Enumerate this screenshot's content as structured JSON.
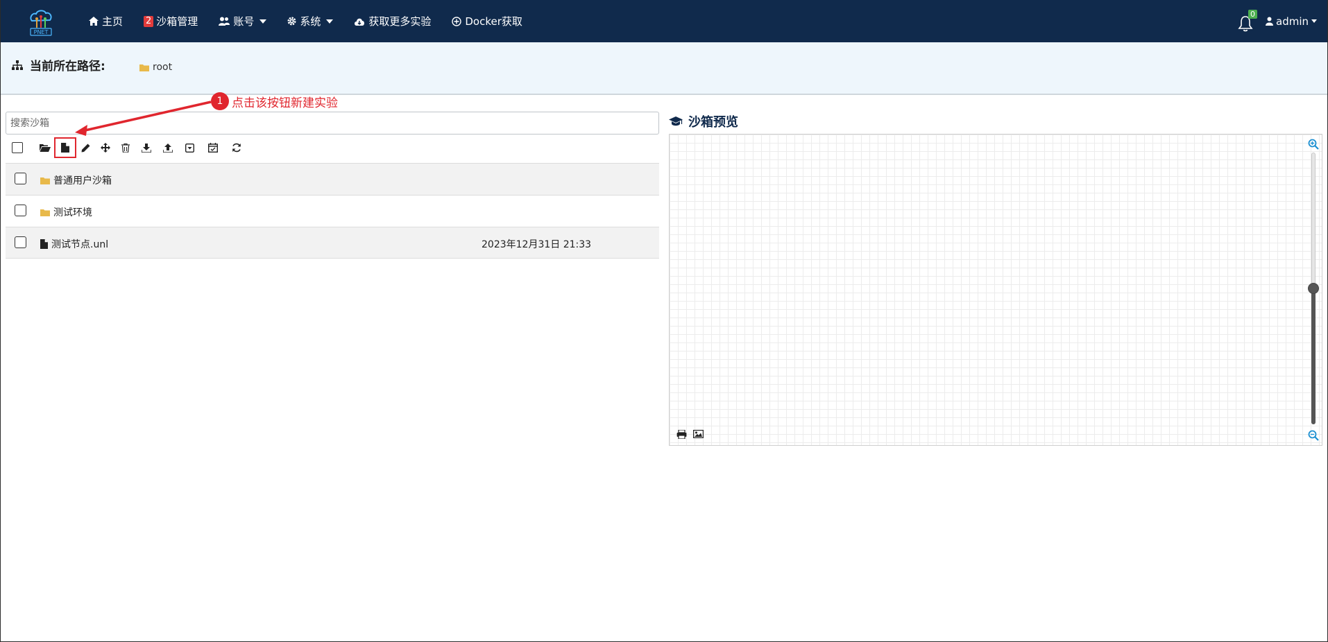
{
  "navbar": {
    "logo_text": "PNET",
    "items": [
      {
        "label": "主页",
        "icon": "home-icon"
      },
      {
        "label": "沙箱管理",
        "badge": "2"
      },
      {
        "label": "账号",
        "icon": "users-icon",
        "dropdown": true
      },
      {
        "label": "系统",
        "icon": "gear-icon",
        "dropdown": true
      },
      {
        "label": "获取更多实验",
        "icon": "cloud-download-icon"
      },
      {
        "label": "Docker获取",
        "icon": "plus-circle-icon"
      }
    ],
    "notification_count": "0",
    "user": "admin"
  },
  "path": {
    "title": "当前所在路径:",
    "root": "root"
  },
  "search": {
    "placeholder": "搜索沙箱"
  },
  "toolbar": {
    "buttons": [
      "open-folder-icon",
      "new-file-icon",
      "pencil-icon",
      "move-icon",
      "trash-icon",
      "download-icon",
      "upload-icon",
      "dropdown-box-icon",
      "calendar-check-icon",
      "refresh-icon"
    ]
  },
  "list": [
    {
      "type": "folder",
      "name": "普通用户沙箱",
      "date": ""
    },
    {
      "type": "folder",
      "name": "测试环境",
      "date": ""
    },
    {
      "type": "file",
      "name": "测试节点.unl",
      "date": "2023年12月31日 21:33"
    }
  ],
  "annotation": {
    "number": "1",
    "text": "点击该按钮新建实验",
    "color": "#e0262e"
  },
  "preview": {
    "title": "沙箱预览",
    "zoom_level": 0.5
  },
  "colors": {
    "navbar": "#102a4c",
    "pathbar": "#eef6fc",
    "folder": "#e8b94a"
  }
}
